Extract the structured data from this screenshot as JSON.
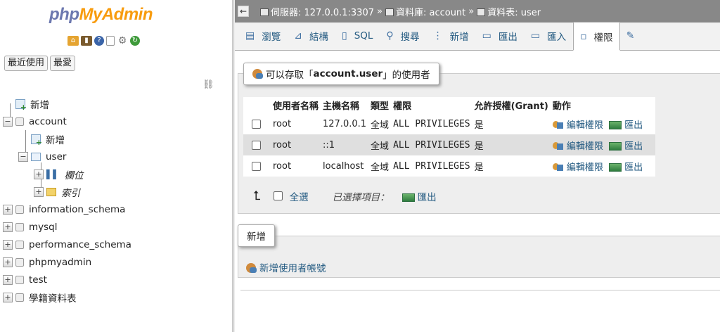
{
  "nav": {
    "logo_php": "php",
    "logo_myadmin": "MyAdmin",
    "quick_tabs": [
      "最近使用",
      "最愛"
    ],
    "icons": [
      "home-icon",
      "logout-icon",
      "help-icon",
      "docs-icon",
      "settings-icon",
      "reload-icon"
    ],
    "tree": {
      "new": "新增",
      "account": "account",
      "account_new": "新增",
      "user": "user",
      "columns": "欄位",
      "indexes": "索引",
      "databases": [
        "information_schema",
        "mysql",
        "performance_schema",
        "phpmyadmin",
        "test",
        "學籍資料表"
      ]
    }
  },
  "breadcrumb": {
    "server": "伺服器: 127.0.0.1:3307",
    "database": "資料庫: account",
    "table": "資料表: user",
    "sep": "»"
  },
  "tabs": [
    {
      "label": "瀏覽",
      "icon": "browse-icon"
    },
    {
      "label": "結構",
      "icon": "structure-icon"
    },
    {
      "label": "SQL",
      "icon": "sql-icon"
    },
    {
      "label": "搜尋",
      "icon": "search-icon"
    },
    {
      "label": "新增",
      "icon": "insert-icon"
    },
    {
      "label": "匯出",
      "icon": "export-icon"
    },
    {
      "label": "匯入",
      "icon": "import-icon"
    },
    {
      "label": "權限",
      "icon": "privileges-icon",
      "active": true
    }
  ],
  "privileges": {
    "legend_prefix": "可以存取「",
    "legend_target": "account.user",
    "legend_suffix": "」的使用者",
    "headers": [
      "使用者名稱",
      "主機名稱",
      "類型",
      "權限",
      "允許授權(Grant)",
      "動作"
    ],
    "rows": [
      {
        "user": "root",
        "host": "127.0.0.1",
        "type": "全域",
        "privileges": "ALL PRIVILEGES",
        "grant": "是",
        "edit": "編輯權限",
        "export": "匯出"
      },
      {
        "user": "root",
        "host": "::1",
        "type": "全域",
        "privileges": "ALL PRIVILEGES",
        "grant": "是",
        "edit": "編輯權限",
        "export": "匯出"
      },
      {
        "user": "root",
        "host": "localhost",
        "type": "全域",
        "privileges": "ALL PRIVILEGES",
        "grant": "是",
        "edit": "編輯權限",
        "export": "匯出"
      }
    ],
    "check_all": "全選",
    "with_selected": "已選擇項目：",
    "bulk_export": "匯出"
  },
  "new_section": {
    "legend": "新增",
    "add_user": "新增使用者帳號"
  }
}
